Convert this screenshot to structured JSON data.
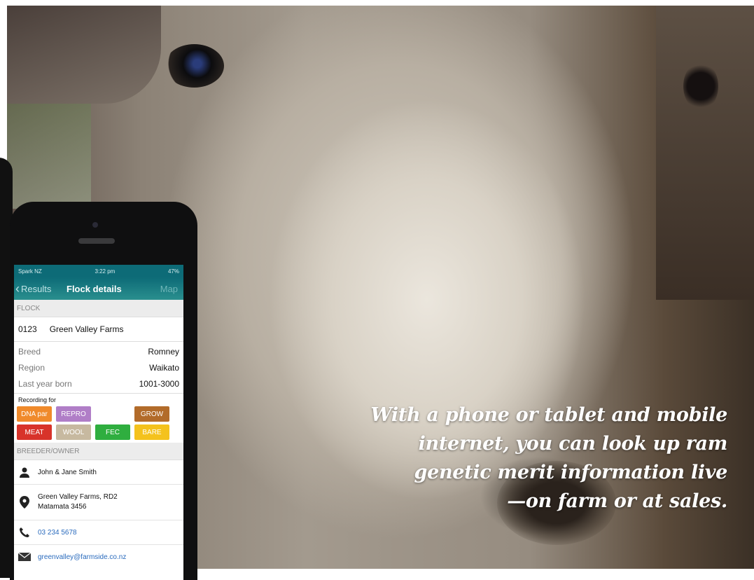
{
  "caption": {
    "line1": "With a phone or tablet and mobile",
    "line2": "internet, you can look up ram",
    "line3": "genetic merit information live",
    "line4": "—on farm or at sales."
  },
  "phone": {
    "status": {
      "carrier": "Spark NZ",
      "time": "3:22 pm",
      "battery": "47%"
    },
    "nav": {
      "back_label": "Results",
      "title": "Flock details",
      "map_label": "Map"
    },
    "flock_section": "FLOCK",
    "flock": {
      "id": "0123",
      "name": "Green Valley Farms"
    },
    "details": [
      {
        "key": "Breed",
        "value": "Romney"
      },
      {
        "key": "Region",
        "value": "Waikato"
      },
      {
        "key": "Last year born",
        "value": "1001-3000"
      }
    ],
    "recording_label": "Recording for",
    "tags": [
      {
        "label": "DNA par",
        "color": "#f08a2b"
      },
      {
        "label": "REPRO",
        "color": "#b07ec7"
      },
      {
        "label": "",
        "color": ""
      },
      {
        "label": "GROW",
        "color": "#b26b2a"
      },
      {
        "label": "MEAT",
        "color": "#d8332a"
      },
      {
        "label": "WOOL",
        "color": "#c7b9a0"
      },
      {
        "label": "FEC",
        "color": "#2fae3f"
      },
      {
        "label": "BARE",
        "color": "#f4c21d"
      }
    ],
    "owner_section": "BREEDER/OWNER",
    "owner_name": "John & Jane Smith",
    "address_line1": "Green Valley Farms, RD2",
    "address_line2": "Matamata 3456",
    "phone": "03 234 5678",
    "email": "greenvalley@farmside.co.nz"
  }
}
